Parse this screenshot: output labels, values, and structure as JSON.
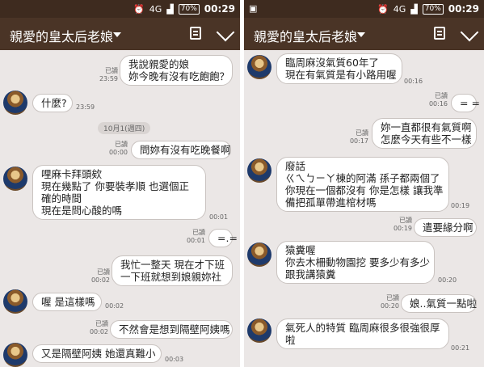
{
  "status": {
    "network": "4G",
    "battery": "70%",
    "time": "00:29"
  },
  "header": {
    "title": "親愛的皇太后老娘"
  },
  "left": {
    "m1": {
      "read": "已讀",
      "time": "23:59",
      "line1": "我說親愛的娘",
      "line2": "妳今晚有沒有吃飽飽？"
    },
    "m2": {
      "text": "什麼?",
      "time": "23:59"
    },
    "date": "10月1(週四)",
    "m3": {
      "read": "已讀",
      "time": "00:00",
      "text": "問妳有沒有吃晚餐啊"
    },
    "m4": {
      "line1": "哩麻卡拜頭欸",
      "line2": "現在幾點了 你要裝孝順 也選個正",
      "line3": "確的時間",
      "line4": "現在是問心酸的嗎",
      "time": "00:01"
    },
    "m5": {
      "read": "已讀",
      "time": "00:01",
      "text": "=.="
    },
    "m6": {
      "read": "已讀",
      "time": "00:02",
      "line1": "我忙一整天 現在才下班",
      "line2": "一下班就想到娘親妳社"
    },
    "m7": {
      "text": "喔 是這樣嗎",
      "time": "00:02"
    },
    "m8": {
      "read": "已讀",
      "time": "00:02",
      "text": "不然會是想到隔壁阿姨嗎"
    },
    "m9": {
      "text": "又是隔壁阿姨 她還真難小",
      "time": "00:03"
    }
  },
  "right": {
    "m1": {
      "line1": "臨周麻沒氣質60年了",
      "line2": "現在有氣質是有小路用喔",
      "time": "00:16"
    },
    "m2": {
      "read": "已讀",
      "time": "00:16",
      "text": "= ="
    },
    "m3": {
      "read": "已讀",
      "time": "00:17",
      "line1": "妳一直都很有氣質啊",
      "line2": "怎麼今天有些不一樣"
    },
    "m4": {
      "line1": "廢話",
      "line2": "ㄍㄟㄅㄧㄚ棟的阿滿 孫子都兩個了",
      "line3": "你現在一個都沒有 你是怎樣 讓我準",
      "line4": "備把孤單帶進棺材嗎",
      "time": "00:19"
    },
    "m5": {
      "read": "已讀",
      "time": "00:19",
      "text": "遣要緣分啊"
    },
    "m6": {
      "line1": "猿糞喔",
      "line2": "你去木柵動物園挖 要多少有多少",
      "line3": "跟我講猿糞",
      "time": "00:20"
    },
    "m7": {
      "read": "已讀",
      "time": "00:20",
      "text": "娘..氣質一點啦"
    },
    "m8": {
      "line1": "氣死人的特質 臨周麻很多很強很厚",
      "line2": "啦",
      "time": "00:21"
    }
  }
}
